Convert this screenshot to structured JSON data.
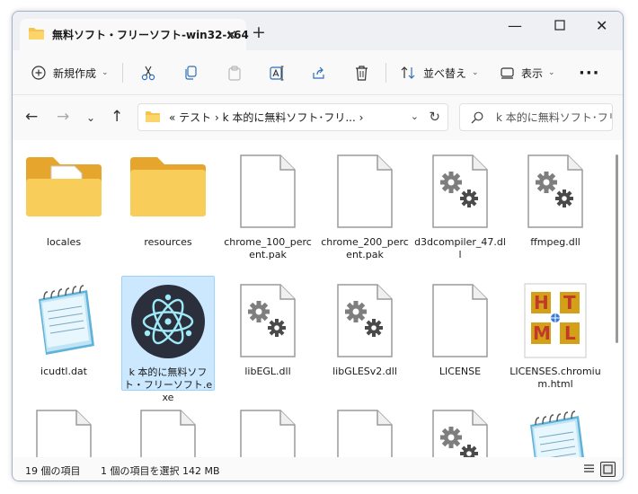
{
  "window": {
    "tab_title": "無料ソフト・フリーソフト-win32-x64"
  },
  "toolbar": {
    "new_label": "新規作成",
    "sort_label": "並べ替え",
    "view_label": "表示"
  },
  "address": {
    "breadcrumb": "«  テスト  ›  k 本的に無料ソフト･フリ...  ›",
    "search_placeholder": "k 本的に無料ソフト･フリ..."
  },
  "files": [
    {
      "name": "locales",
      "icon": "folder-docs-icon"
    },
    {
      "name": "resources",
      "icon": "folder-icon"
    },
    {
      "name": "chrome_100_percent.pak",
      "icon": "blank-file-icon"
    },
    {
      "name": "chrome_200_percent.pak",
      "icon": "blank-file-icon"
    },
    {
      "name": "d3dcompiler_47.dll",
      "icon": "dll-file-icon"
    },
    {
      "name": "ffmpeg.dll",
      "icon": "dll-file-icon"
    },
    {
      "name": "icudtl.dat",
      "icon": "notepad-icon"
    },
    {
      "name": "k 本的に無料ソフト・フリーソフト.exe",
      "icon": "electron-app-icon",
      "selected": true
    },
    {
      "name": "libEGL.dll",
      "icon": "dll-file-icon"
    },
    {
      "name": "libGLESv2.dll",
      "icon": "dll-file-icon"
    },
    {
      "name": "LICENSE",
      "icon": "blank-file-icon"
    },
    {
      "name": "LICENSES.chromium.html",
      "icon": "html-file-icon"
    },
    {
      "name": "",
      "icon": "blank-file-icon"
    },
    {
      "name": "",
      "icon": "blank-file-icon"
    },
    {
      "name": "",
      "icon": "blank-file-icon"
    },
    {
      "name": "",
      "icon": "blank-file-icon"
    },
    {
      "name": "",
      "icon": "dll-file-icon"
    },
    {
      "name": "",
      "icon": "notepad-icon"
    }
  ],
  "status": {
    "count": "19 個の項目",
    "selection": "1 個の項目を選択  142 MB"
  }
}
